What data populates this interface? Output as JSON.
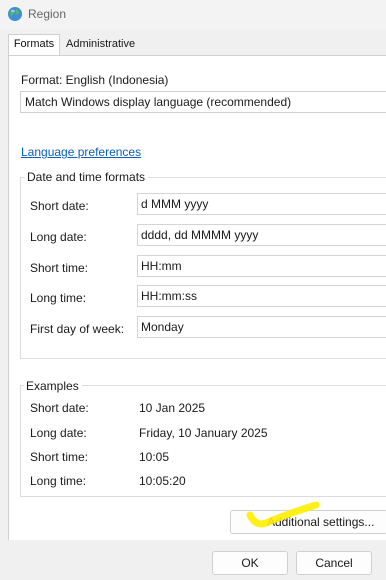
{
  "window": {
    "title": "Region"
  },
  "tabs": [
    {
      "label": "Formats",
      "active": true
    },
    {
      "label": "Administrative",
      "active": false
    }
  ],
  "format": {
    "label": "Format: English (Indonesia)",
    "selected": "Match Windows display language (recommended)"
  },
  "language_link": "Language preferences",
  "date_time_formats": {
    "title": "Date and time formats",
    "rows": [
      {
        "label": "Short date:",
        "value": "d MMM yyyy"
      },
      {
        "label": "Long date:",
        "value": "dddd, dd MMMM yyyy"
      },
      {
        "label": "Short time:",
        "value": "HH:mm"
      },
      {
        "label": "Long time:",
        "value": "HH:mm:ss"
      },
      {
        "label": "First day of week:",
        "value": "Monday"
      }
    ]
  },
  "examples": {
    "title": "Examples",
    "rows": [
      {
        "label": "Short date:",
        "value": "10 Jan 2025"
      },
      {
        "label": "Long date:",
        "value": "Friday, 10 January 2025"
      },
      {
        "label": "Short time:",
        "value": "10:05"
      },
      {
        "label": "Long time:",
        "value": "10:05:20"
      }
    ]
  },
  "buttons": {
    "additional": "Additional settings...",
    "ok": "OK",
    "cancel": "Cancel"
  },
  "colors": {
    "link": "#0a5fbe",
    "highlight": "#ffee00"
  },
  "icons": {
    "window": "globe-icon"
  }
}
